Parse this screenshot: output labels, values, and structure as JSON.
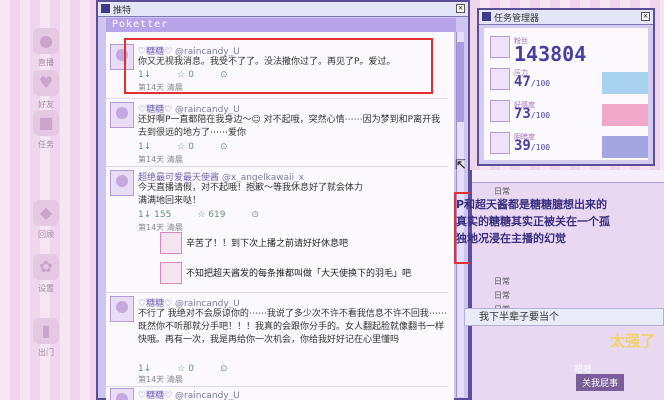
{
  "desktop_icons": [
    "直播",
    "好友",
    "任务",
    "回顾",
    "设置",
    "出门"
  ],
  "main_window": {
    "title": "推特",
    "app_name": "Poketter",
    "posts": [
      {
        "name": "♡糖糖♡",
        "handle": "@raincandy_U",
        "text": "你又无视我消息。我受不了了。没法撒你过了。再见了P。爱过。",
        "retweets": "1↓",
        "likes": "☆ 0",
        "more": "⊙",
        "time": "第14天 清晨"
      },
      {
        "name": "♡糖糖♡",
        "handle": "@raincandy_U",
        "text": "还好啊P一直都陪在我身边～☺ 对不起哦，突然心情⋯⋯因为梦到和P离开我去到很远的地方了⋯⋯爱你",
        "retweets": "1↓",
        "likes": "☆ 0",
        "more": "⊙",
        "time": "第14天 清晨"
      },
      {
        "name": "超绝最可爱最天使酱",
        "handle": "@x_angelkawaii_x",
        "text": "今天直播请假，对不起哦！抱歉～等我休息好了就会体力满满地回来哒！",
        "retweets": "1↓ 155",
        "likes": "☆ 619",
        "more": "⊙",
        "time": "第14天 清晨"
      },
      {
        "name": "♡糖糖♡",
        "handle": "@raincandy_U",
        "text": "不行了 我绝对不会原谅你的⋯⋯我说了多少次不许不看我信息不许不回我⋯⋯既然你不听那就分手吧！！！我真的会跟你分手的。女人翻起脸就像翻书一样快哦。再有一次，我是再给你一次机会，你给我好好记在心里懂吗",
        "retweets": "1↓",
        "likes": "☆ 0",
        "more": "⊙",
        "time": "第14天 清晨"
      },
      {
        "name": "♡糖糖♡",
        "handle": "@raincandy_U",
        "text": "",
        "retweets": "",
        "likes": "",
        "more": "",
        "time": ""
      }
    ],
    "replies": [
      {
        "text": "辛苦了！！到下次上播之前请好好休息吧"
      },
      {
        "text": "不知把超天酱发的每条推都叫做「大天使换下的羽毛」吧"
      }
    ]
  },
  "status_window": {
    "title": "任务管理器",
    "followers_label": "粉丝",
    "followers": "143804",
    "stats": [
      {
        "label": "压力",
        "value": "47",
        "max": "/100"
      },
      {
        "label": "好感度",
        "value": "73",
        "max": "/100"
      },
      {
        "label": "阴暗度",
        "value": "39",
        "max": "/100"
      }
    ]
  },
  "right_window": {
    "lines": [
      "日常",
      "日常",
      "日常",
      "日常"
    ],
    "dialog": "P和超天酱都是糖糖臆想出来的 真实的糖糖其实正被关在一个孤独地况浸在主播的幻觉",
    "bottom": "我下半辈子要当个",
    "tag": "关我屁事",
    "tag_small": "嗯嗯",
    "big_text": "太强了"
  },
  "highlight_color": "#e03030"
}
